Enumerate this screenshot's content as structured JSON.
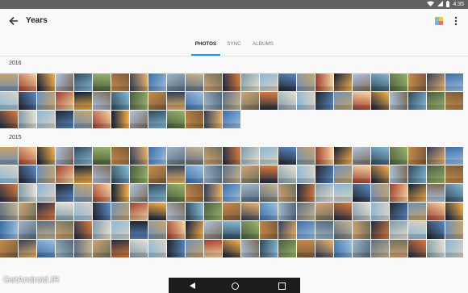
{
  "status_bar": {
    "time": "4:35",
    "wifi_icon": "wifi-icon",
    "signal_icon": "signal-icon",
    "battery_icon": "battery-icon"
  },
  "app_bar": {
    "title": "Years",
    "back_icon": "arrow-left-icon",
    "photo_icon": "photos-icon",
    "menu_icon": "more-vert-icon"
  },
  "tabs": [
    {
      "label": "PHOTOS",
      "active": true
    },
    {
      "label": "SYNC",
      "active": false
    },
    {
      "label": "ALBUMS",
      "active": false
    }
  ],
  "sections": [
    {
      "year": "2016",
      "thumbnail_count": 63
    },
    {
      "year": "2015",
      "thumbnail_count": 150
    }
  ],
  "watermark": "GetAndroid.IR",
  "nav_bar": {
    "back_icon": "nav-back-icon",
    "home_icon": "nav-home-icon",
    "recents_icon": "nav-recents-icon"
  },
  "colors": {
    "accent": "#2196f3",
    "status_bar": "#616161",
    "nav_bar": "#1c1c1c"
  }
}
